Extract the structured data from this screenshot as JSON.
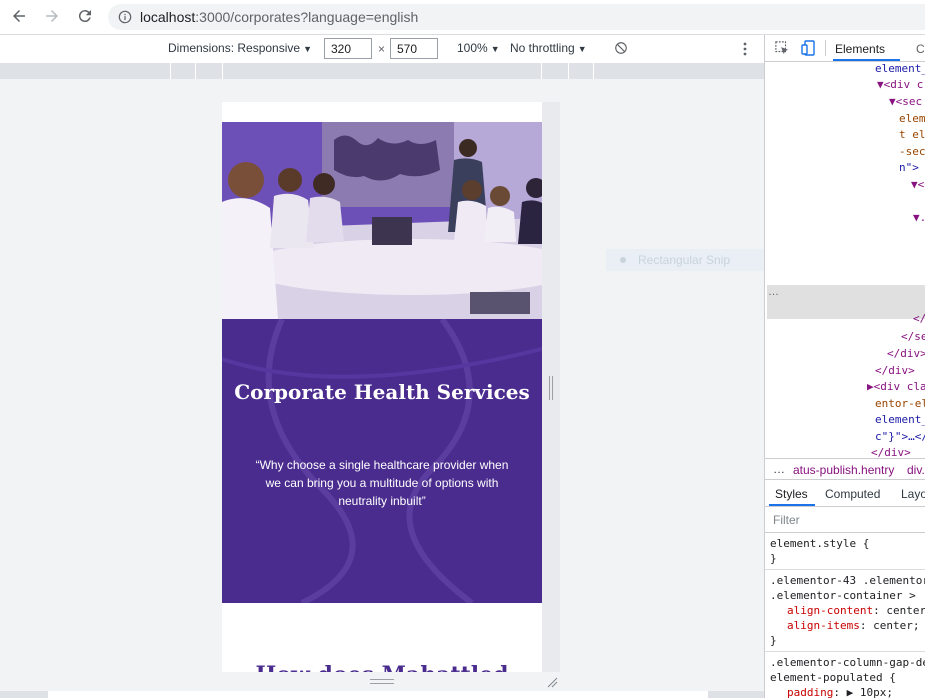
{
  "browser": {
    "url_host": "localhost",
    "url_rest": ":3000/corporates?language=english"
  },
  "device_toolbar": {
    "dimensions_label": "Dimensions: Responsive",
    "width_value": "320",
    "height_value": "570",
    "times_symbol": "×",
    "zoom_label": "100%",
    "throttling_label": "No throttling"
  },
  "page": {
    "hero_title": "Corporate Health Services",
    "hero_quote": "“Why choose a single healthcare provider when we can bring you a multitude of options with neutrality inbuilt”",
    "next_heading": "How does Mahattled"
  },
  "snip_overlay": {
    "label": "Rectangular Snip"
  },
  "devtools": {
    "tabs": {
      "elements": "Elements",
      "console": "Co"
    },
    "dom_lines": [
      {
        "parts": [
          [
            "attrval",
            "element_"
          ]
        ]
      },
      {
        "parts": [
          [
            "tag",
            "▼<div c"
          ]
        ]
      },
      {
        "parts": [
          [
            "tag",
            "▼<sec"
          ]
        ]
      },
      {
        "parts": [
          [
            "attr",
            "elem"
          ]
        ]
      },
      {
        "parts": [
          [
            "attr",
            "t el"
          ]
        ]
      },
      {
        "parts": [
          [
            "attr",
            "-sec"
          ]
        ]
      },
      {
        "parts": [
          [
            "attrval",
            "n\">"
          ]
        ]
      },
      {
        "parts": [
          [
            "tag",
            "▼<d"
          ]
        ]
      },
      {
        "parts": [
          [
            "tag",
            "▼."
          ]
        ]
      },
      {
        "parts": [
          [
            "tag",
            "</"
          ]
        ]
      },
      {
        "parts": [
          [
            "tag",
            "</se"
          ]
        ]
      },
      {
        "parts": [
          [
            "tag",
            "</div>"
          ]
        ]
      },
      {
        "parts": [
          [
            "tag",
            "</div>"
          ]
        ]
      },
      {
        "parts": [
          [
            "tag",
            "▶<div cla"
          ]
        ]
      },
      {
        "parts": [
          [
            "attr",
            "entor-el"
          ]
        ]
      },
      {
        "parts": [
          [
            "attrval",
            "element_"
          ]
        ]
      },
      {
        "parts": [
          [
            "attrval",
            "c\"}\">…</"
          ]
        ]
      },
      {
        "parts": [
          [
            "tag",
            "</div>"
          ]
        ]
      }
    ],
    "dom_ellipsis": "…",
    "breadcrumbs": {
      "more": "…",
      "item1": "atus-publish.hentry",
      "item2": "div."
    },
    "styles_tabs": {
      "styles": "Styles",
      "computed": "Computed",
      "layout": "Layo"
    },
    "filter_placeholder": "Filter",
    "rules": {
      "r1_selector": "element.style {",
      "r1_close": "}",
      "r2_sel1": ".elementor-43 .elementor",
      "r2_sel2": ".elementor-container > .",
      "r2_p1_name": "align-content",
      "r2_p1_val": "center",
      "r2_p2_name": "align-items",
      "r2_p2_val": "center;",
      "r2_close": "}",
      "r3_sel1": ".elementor-column-gap-de",
      "r3_sel2": "element-populated {",
      "r3_p1_name": "padding",
      "r3_p1_val": "▶ 10px;"
    }
  }
}
